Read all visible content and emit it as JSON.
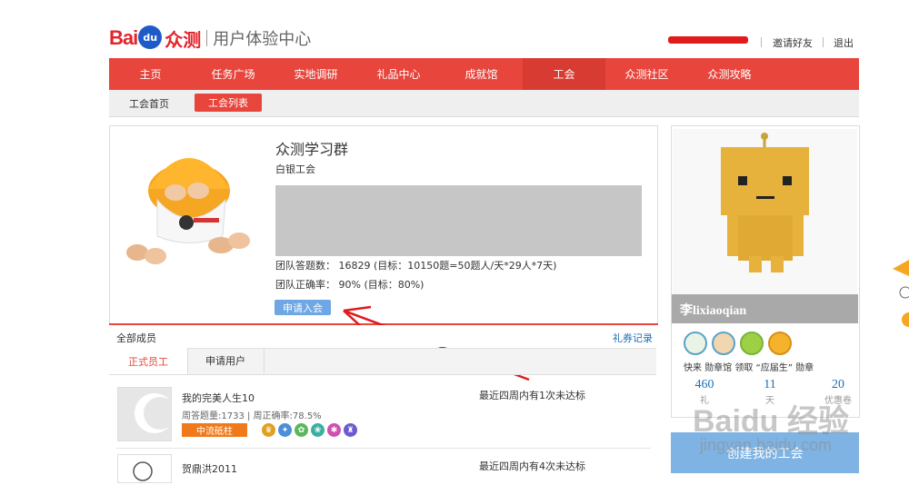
{
  "header": {
    "logo_bai": "Bai",
    "logo_du": "du",
    "logo_zc": "众测",
    "logo_subtitle": "用户体验中心",
    "invite_label": "邀请好友",
    "logout_label": "退出"
  },
  "main_nav": {
    "items": [
      {
        "label": "主页"
      },
      {
        "label": "任务广场"
      },
      {
        "label": "实地调研"
      },
      {
        "label": "礼品中心"
      },
      {
        "label": "成就馆"
      },
      {
        "label": "工会"
      },
      {
        "label": "众测社区"
      },
      {
        "label": "众测攻略"
      }
    ],
    "active": "工会"
  },
  "sub_nav": {
    "home_label": "工会首页",
    "list_label": "工会列表"
  },
  "group": {
    "title": "众测学习群",
    "level": "白银工会",
    "stat_answers": "团队答题数： 16829 (目标：10150题=50题人/天*29人*7天)",
    "stat_accuracy": "团队正确率： 90% (目标：80%)",
    "apply_label": "申请入会"
  },
  "members": {
    "all_label": "全部成员",
    "coupon_label": "礼券记录",
    "tab_staff": "正式员工",
    "tab_apply": "申请用户",
    "rows": [
      {
        "name": "我的完美人生10",
        "stats": "周答题量:1733 | 周正确率:78.5%",
        "status": "最近四周内有1次未达标",
        "badge": "中流砥柱"
      },
      {
        "name": "贺鼎洪2011",
        "stats": "",
        "status": "最近四周内有4次未达标",
        "badge": ""
      }
    ]
  },
  "profile": {
    "name": "李lixiaoqian",
    "badge_text": "快来 勋章馆 领取 “应届生” 勋章",
    "stats": [
      {
        "value": "460",
        "label": "礼"
      },
      {
        "value": "11",
        "label": "天"
      },
      {
        "value": "20",
        "label": "优惠卷"
      }
    ],
    "create_label": "创建我的工会"
  },
  "watermark": {
    "main": "Baidu 经验",
    "sub": "jingyan.baidu.com"
  },
  "colors": {
    "nav_red": "#e8453c",
    "link_blue": "#1a6fb8",
    "apply_blue": "#6fa7e4",
    "badge_orange": "#f07a1a"
  }
}
